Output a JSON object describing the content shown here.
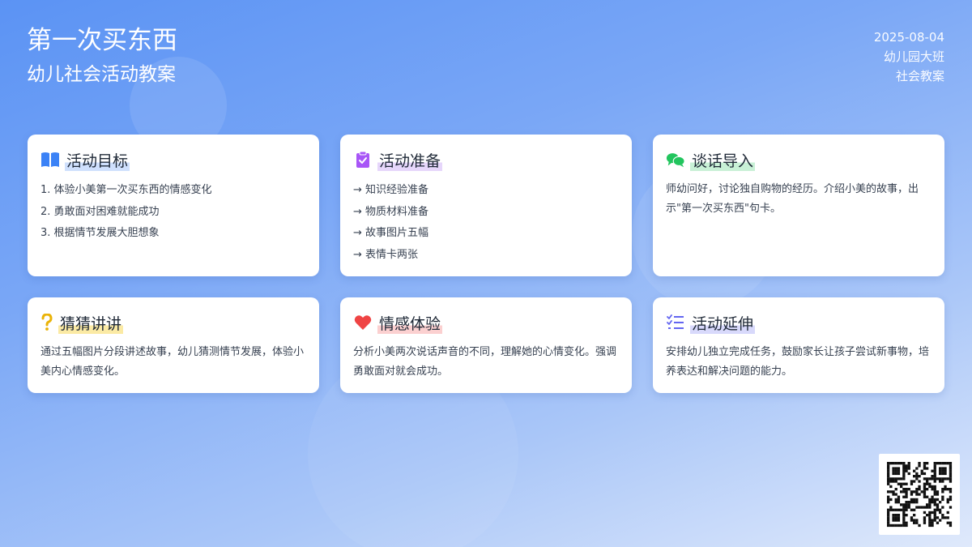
{
  "header": {
    "title": "第一次买东西",
    "subtitle": "幼儿社会活动教案",
    "date": "2025-08-04",
    "class": "幼儿园大班",
    "category": "社会教案"
  },
  "cards": [
    {
      "title": "活动目标",
      "icon": "book-icon",
      "items": [
        "1. 体验小美第一次买东西的情感变化",
        "2. 勇敢面对困难就能成功",
        "3. 根据情节发展大胆想象"
      ]
    },
    {
      "title": "活动准备",
      "icon": "clipboard-check-icon",
      "items": [
        "→ 知识经验准备",
        "→ 物质材料准备",
        "→ 故事图片五幅",
        "→ 表情卡两张"
      ]
    },
    {
      "title": "谈话导入",
      "icon": "chat-bubbles-icon",
      "text": "师幼问好，讨论独自购物的经历。介绍小美的故事，出示\"第一次买东西\"句卡。"
    },
    {
      "title": "猜猜讲讲",
      "icon": "question-mark-icon",
      "text": "通过五幅图片分段讲述故事，幼儿猜测情节发展，体验小美内心情感变化。"
    },
    {
      "title": "情感体验",
      "icon": "heart-icon",
      "text": "分析小美两次说话声音的不同，理解她的心情变化。强调勇敢面对就会成功。"
    },
    {
      "title": "活动延伸",
      "icon": "checklist-icon",
      "text": "安排幼儿独立完成任务，鼓励家长让孩子尝试新事物，培养表达和解决问题的能力。"
    }
  ],
  "colors": {
    "background_start": "#5b93f4",
    "background_end": "#dfe9fb",
    "icon_blue": "#3b82f6",
    "icon_purple": "#a855f7",
    "icon_green": "#22c55e",
    "icon_yellow": "#eab308",
    "icon_red": "#ef4444",
    "icon_indigo": "#6366f1"
  },
  "qr_code": {
    "icon": "qr-code-icon"
  }
}
